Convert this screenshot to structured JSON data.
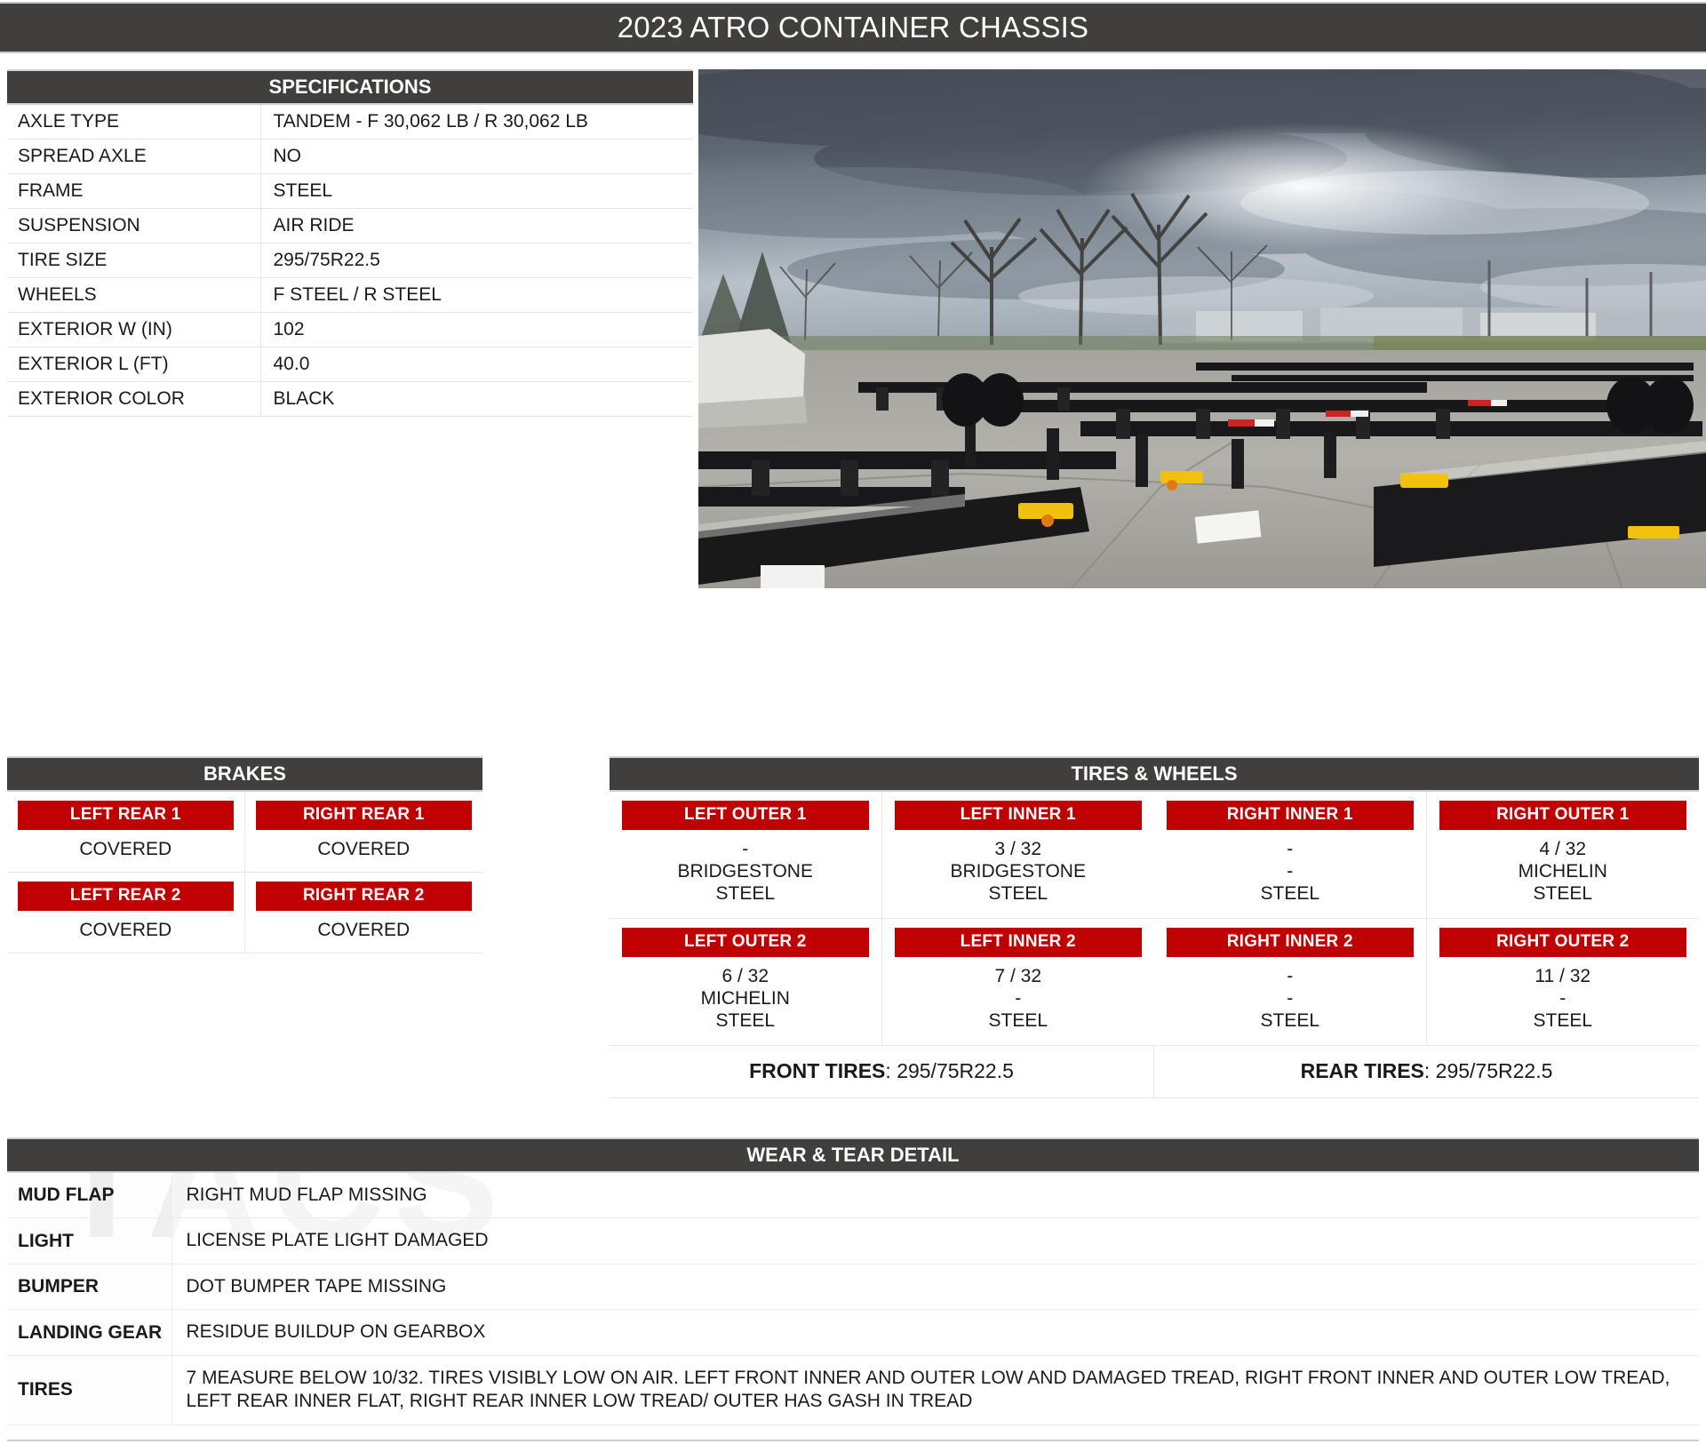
{
  "title": "2023 ATRO CONTAINER CHASSIS",
  "colors": {
    "header_bar": "#403f3e",
    "label_red": "#c00000",
    "page_bg": "#ffffff",
    "rule": "#cfcfcf"
  },
  "specifications": {
    "heading": "SPECIFICATIONS",
    "rows": [
      {
        "label": "AXLE TYPE",
        "value": "TANDEM - F 30,062 LB / R 30,062 LB"
      },
      {
        "label": "SPREAD AXLE",
        "value": "NO"
      },
      {
        "label": "FRAME",
        "value": "STEEL"
      },
      {
        "label": "SUSPENSION",
        "value": "AIR RIDE"
      },
      {
        "label": "TIRE SIZE",
        "value": "295/75R22.5"
      },
      {
        "label": "WHEELS",
        "value": "F STEEL / R STEEL"
      },
      {
        "label": "EXTERIOR W (IN)",
        "value": "102"
      },
      {
        "label": "EXTERIOR L (FT)",
        "value": "40.0"
      },
      {
        "label": "EXTERIOR COLOR",
        "value": "BLACK"
      }
    ]
  },
  "photo": {
    "alt": "container chassis trailers parked on concrete lot under cloudy sky"
  },
  "brakes": {
    "heading": "BRAKES",
    "cells": [
      {
        "position": "LEFT REAR 1",
        "value": "COVERED"
      },
      {
        "position": "RIGHT REAR 1",
        "value": "COVERED"
      },
      {
        "position": "LEFT REAR 2",
        "value": "COVERED"
      },
      {
        "position": "RIGHT REAR 2",
        "value": "COVERED"
      }
    ]
  },
  "tires_wheels": {
    "heading": "TIRES & WHEELS",
    "cells": [
      {
        "position": "LEFT OUTER 1",
        "tread": "-",
        "brand": "BRIDGESTONE",
        "wheel": "STEEL"
      },
      {
        "position": "LEFT INNER 1",
        "tread": "3 / 32",
        "brand": "BRIDGESTONE",
        "wheel": "STEEL"
      },
      {
        "position": "RIGHT INNER 1",
        "tread": "-",
        "brand": "-",
        "wheel": "STEEL"
      },
      {
        "position": "RIGHT OUTER 1",
        "tread": "4 / 32",
        "brand": "MICHELIN",
        "wheel": "STEEL"
      },
      {
        "position": "LEFT OUTER 2",
        "tread": "6 / 32",
        "brand": "MICHELIN",
        "wheel": "STEEL"
      },
      {
        "position": "LEFT INNER 2",
        "tread": "7 / 32",
        "brand": "-",
        "wheel": "STEEL"
      },
      {
        "position": "RIGHT INNER 2",
        "tread": "-",
        "brand": "-",
        "wheel": "STEEL"
      },
      {
        "position": "RIGHT OUTER 2",
        "tread": "11 / 32",
        "brand": "-",
        "wheel": "STEEL"
      }
    ],
    "front_tires_label": "FRONT TIRES",
    "front_tires_value": "295/75R22.5",
    "rear_tires_label": "REAR TIRES",
    "rear_tires_value": "295/75R22.5"
  },
  "wear_tear": {
    "heading": "WEAR & TEAR DETAIL",
    "watermark": "TACS",
    "rows": [
      {
        "label": "MUD FLAP",
        "value": "RIGHT MUD FLAP MISSING"
      },
      {
        "label": "LIGHT",
        "value": "LICENSE PLATE LIGHT DAMAGED"
      },
      {
        "label": "BUMPER",
        "value": "DOT BUMPER TAPE MISSING"
      },
      {
        "label": "LANDING GEAR",
        "value": "RESIDUE BUILDUP ON GEARBOX"
      },
      {
        "label": "TIRES",
        "value": "7 MEASURE BELOW 10/32. TIRES VISIBLY LOW ON AIR. LEFT FRONT INNER AND OUTER LOW AND DAMAGED TREAD, RIGHT FRONT INNER AND OUTER LOW TREAD, LEFT REAR INNER FLAT, RIGHT REAR INNER LOW TREAD/ OUTER HAS GASH IN TREAD"
      }
    ]
  }
}
